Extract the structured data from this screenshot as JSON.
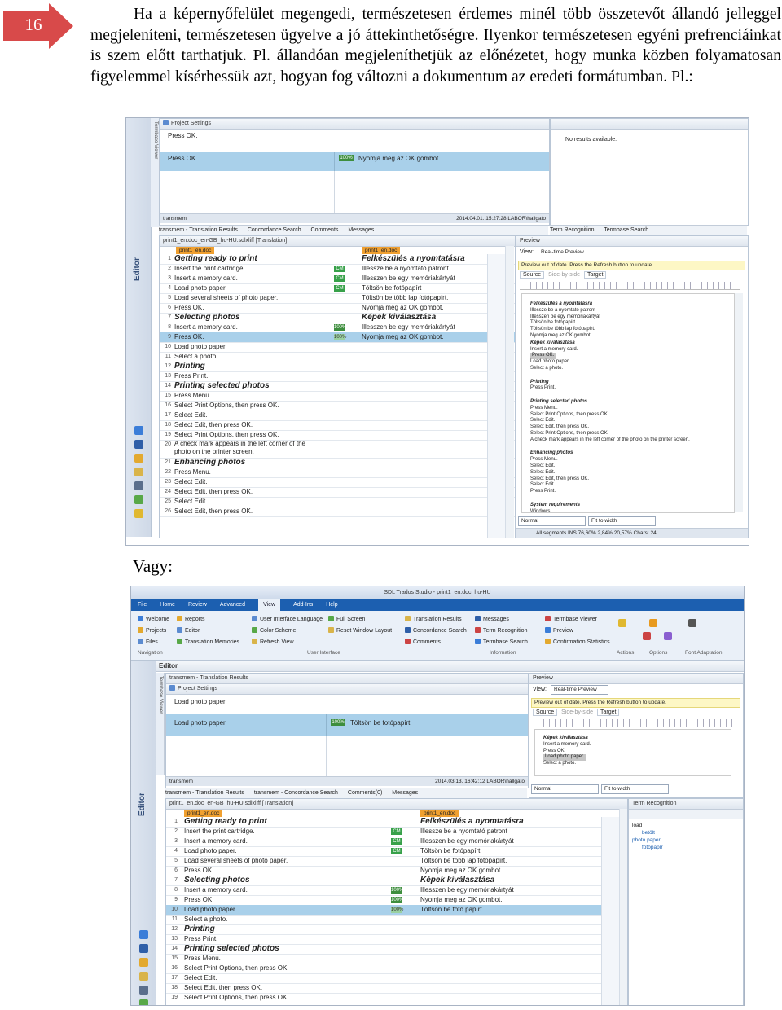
{
  "page_number": "16",
  "paragraph": "Ha a képernyőfelület megengedi, természetesen érdemes minél több összetevőt állandó jelleggel megjeleníteni, természetesen ügyelve a jó áttekinthetőségre. Ilyenkor természetesen egyéni prefrenciáinkat is szem előtt tarthatjuk. Pl. állandóan megjeleníthetjük az előnézetet, hogy munka közben folyamatosan figyelemmel kísérhessük azt, hogyan fog változni a dokumentum az eredeti formátumban. Pl.:",
  "vagy": "Vagy:",
  "colors": {
    "arrow": "#d84a4a",
    "selection": "#a9d0ea",
    "cm": "#38a14a",
    "menubar": "#1c5fb0"
  },
  "shot1": {
    "termbase_viewer": "Termbase Viewer",
    "project_settings": "Project Settings",
    "press_ok_label": "Press OK.",
    "press_ok_src": "Press OK.",
    "match_pct": "100%",
    "match_tgt": "Nyomja meg az OK gombot.",
    "no_results": "No results available.",
    "tm_status_left": "transmem",
    "tm_status_right": "2014.04.01. 15:27:28 LABOR\\hallgato",
    "tabs": [
      "transmem - Translation Results",
      "Concordance Search",
      "Comments",
      "Messages"
    ],
    "right_tabs": [
      "Term Recognition",
      "Termbase Search"
    ],
    "file_title": "print1_en.doc_en-GB_hu-HU.sdlxliff [Translation]",
    "editor_label": "Editor",
    "src_tag": "print1_en.doc",
    "tgt_tag": "print1_en.doc",
    "preview_title": "Preview",
    "view_label": "View:",
    "view_value": "Real-time Preview",
    "out_of_date": "Preview out of date. Press the Refresh button to update.",
    "preview_tabs": [
      "Source",
      "Side-by-side",
      "Target"
    ],
    "zoom_normal": "Normal",
    "zoom_fit": "Fit to width",
    "status_bar": "All segments  INS  76,60%  2,84%  20,57%  Chars: 24",
    "rows": [
      {
        "n": "1",
        "src": "Getting ready to print",
        "tgt": "Felkészülés a nyomtatásra",
        "st": "",
        "ty": "H",
        "hd": true
      },
      {
        "n": "2",
        "src": "Insert the print cartridge.",
        "tgt": "Illessze be a nyomtató patront",
        "st": "CM",
        "ty": "P"
      },
      {
        "n": "3",
        "src": "Insert a memory card.",
        "tgt": "Illesszen be egy memóriakártyát",
        "st": "CM",
        "ty": "P"
      },
      {
        "n": "4",
        "src": "Load photo paper.",
        "tgt": "Töltsön be  fotópapírt",
        "st": "CM",
        "ty": "P"
      },
      {
        "n": "5",
        "src": "Load several sheets of photo paper.",
        "tgt": "Töltsön be több lap fotópapírt.",
        "st": "",
        "ty": "P"
      },
      {
        "n": "6",
        "src": "Press OK.",
        "tgt": "Nyomja meg az OK gombot.",
        "st": "",
        "ty": "P"
      },
      {
        "n": "7",
        "src": "Selecting photos",
        "tgt": "Képek kiválasztása",
        "st": "",
        "ty": "H",
        "hd": true
      },
      {
        "n": "8",
        "src": "Insert a memory card.",
        "tgt": "Illesszen be egy memóriakártyát",
        "st": "100%",
        "ty": "P"
      },
      {
        "n": "9",
        "src": "Press OK.",
        "tgt": "Nyomja meg az OK gombot.",
        "st": "100%",
        "ty": "P",
        "sel": true
      },
      {
        "n": "10",
        "src": "Load photo paper.",
        "tgt": "",
        "st": "",
        "ty": "P"
      },
      {
        "n": "11",
        "src": "Select a photo.",
        "tgt": "",
        "st": "",
        "ty": "P"
      },
      {
        "n": "12",
        "src": "Printing",
        "tgt": "",
        "st": "",
        "ty": "H",
        "hd": true
      },
      {
        "n": "13",
        "src": "Press Print.",
        "tgt": "",
        "st": "",
        "ty": "P"
      },
      {
        "n": "14",
        "src": "Printing selected photos",
        "tgt": "",
        "st": "",
        "ty": "H",
        "hd": true
      },
      {
        "n": "15",
        "src": "Press Menu.",
        "tgt": "",
        "st": "",
        "ty": "P"
      },
      {
        "n": "16",
        "src": "Select Print Options, then press OK.",
        "tgt": "",
        "st": "",
        "ty": "P"
      },
      {
        "n": "17",
        "src": "Select Edit.",
        "tgt": "",
        "st": "",
        "ty": "P"
      },
      {
        "n": "18",
        "src": "Select Edit, then press OK.",
        "tgt": "",
        "st": "",
        "ty": "P"
      },
      {
        "n": "19",
        "src": "Select Print Options, then press OK.",
        "tgt": "",
        "st": "",
        "ty": "P"
      },
      {
        "n": "20",
        "src": "A check mark appears in the left corner of the photo on the printer screen.",
        "tgt": "",
        "st": "",
        "ty": "P",
        "tall": true
      },
      {
        "n": "21",
        "src": "Enhancing photos",
        "tgt": "",
        "st": "",
        "ty": "H",
        "hd": true
      },
      {
        "n": "22",
        "src": "Press Menu.",
        "tgt": "",
        "st": "",
        "ty": "P"
      },
      {
        "n": "23",
        "src": "Select Edit.",
        "tgt": "",
        "st": "",
        "ty": "P"
      },
      {
        "n": "24",
        "src": "Select Edit, then press OK.",
        "tgt": "",
        "st": "",
        "ty": "P"
      },
      {
        "n": "25",
        "src": "Select Edit.",
        "tgt": "",
        "st": "",
        "ty": "P"
      },
      {
        "n": "26",
        "src": "Select Edit, then press OK.",
        "tgt": "",
        "st": "",
        "ty": "P"
      }
    ],
    "preview_lines": [
      {
        "t": "Felkészülés a nyomtatásra",
        "b": true
      },
      {
        "t": "Illessze be a nyomtató patront"
      },
      {
        "t": "Illesszen be egy memóriakártyát"
      },
      {
        "t": "Töltsön be  fotópapírt"
      },
      {
        "t": "Töltsön be több lap fotópapírt."
      },
      {
        "t": "Nyomja meg az OK gombot."
      },
      {
        "t": "Képek kiválasztása",
        "b": true
      },
      {
        "t": "Insert a memory card."
      },
      {
        "t": "Press OK.",
        "hl": true
      },
      {
        "t": "Load photo paper."
      },
      {
        "t": "Select a photo."
      },
      {
        "t": ""
      },
      {
        "t": "Printing",
        "b": true
      },
      {
        "t": "Press Print."
      },
      {
        "t": ""
      },
      {
        "t": "Printing selected photos",
        "b": true
      },
      {
        "t": "Press Menu."
      },
      {
        "t": "Select Print Options, then press OK."
      },
      {
        "t": "Select Edit."
      },
      {
        "t": "Select Edit, then press OK."
      },
      {
        "t": "Select Print Options, then press OK."
      },
      {
        "t": "A check mark appears in the left corner of the photo on the printer screen."
      },
      {
        "t": ""
      },
      {
        "t": "Enhancing photos",
        "b": true
      },
      {
        "t": "Press Menu."
      },
      {
        "t": "Select Edit."
      },
      {
        "t": "Select Edit."
      },
      {
        "t": "Select Edit, then press OK."
      },
      {
        "t": "Select Edit."
      },
      {
        "t": "Press Print."
      },
      {
        "t": ""
      },
      {
        "t": "System requirements",
        "b": true
      },
      {
        "t": "Windows"
      }
    ]
  },
  "shot2": {
    "window_title": "SDL Trados Studio - print1_en.doc_hu-HU",
    "menu": [
      "File",
      "Home",
      "Review",
      "Advanced",
      "View",
      "Add-Ins",
      "Help"
    ],
    "menu_active": "View",
    "groups": [
      {
        "items": [
          "Welcome",
          "Projects",
          "Files"
        ],
        "cap": "Navigation"
      },
      {
        "items": [
          "Reports",
          "Editor",
          "Translation Memories"
        ],
        "cap": ""
      },
      {
        "items": [
          "User Interface Language",
          "Color Scheme",
          "Refresh View"
        ],
        "cap": "User Interface"
      },
      {
        "items": [
          "Full Screen",
          "Reset Window Layout"
        ],
        "cap": ""
      },
      {
        "items": [
          "Translation Results",
          "Concordance Search",
          "Comments"
        ],
        "cap": ""
      },
      {
        "items": [
          "Messages",
          "Term Recognition",
          "Termbase Search"
        ],
        "cap": "Information"
      },
      {
        "items": [
          "Termbase Viewer",
          "Preview",
          "Confirmation Statistics"
        ],
        "cap": ""
      }
    ],
    "right_caps": [
      "Actions",
      "Options",
      "Font Adaptation"
    ],
    "editor_label": "Editor",
    "tm_title": "transmem - Translation Results",
    "project_settings": "Project Settings",
    "load_label": "Load photo paper.",
    "load_src": "Load photo paper.",
    "match_pct": "100%",
    "match_tgt": "Töltsön be  fotópapírt",
    "tm_status_left": "transmem",
    "tm_status_right": "2014.03.13. 16:42:12 LABOR\\hallgato",
    "tabs": [
      "transmem - Translation Results",
      "transmem - Concordance Search",
      "Comments(0)",
      "Messages"
    ],
    "file_title": "print1_en.doc_en-GB_hu-HU.sdlxliff [Translation]",
    "termbase_viewer": "Termbase Viewer",
    "src_tag": "print1_en.doc",
    "tgt_tag": "print1_en.doc",
    "preview_title": "Preview",
    "view_label": "View:",
    "view_value": "Real-time Preview",
    "out_of_date": "Preview out of date. Press the Refresh button to update.",
    "preview_tabs": [
      "Source",
      "Side-by-side",
      "Target"
    ],
    "zoom_normal": "Normal",
    "zoom_fit": "Fit to width",
    "term_title": "Term Recognition",
    "terms": [
      {
        "t": "load",
        "c": "#222"
      },
      {
        "t": "betölt",
        "c": "#1c5fb0",
        "ind": true
      },
      {
        "t": "photo paper",
        "c": "#1c5fb0"
      },
      {
        "t": "fotópapír",
        "c": "#1c5fb0",
        "ind": true
      }
    ],
    "preview_lines": [
      {
        "t": "Képek kiválasztása",
        "b": true
      },
      {
        "t": "Insert a memory card."
      },
      {
        "t": "Press OK."
      },
      {
        "t": "Load photo paper.",
        "hl": true
      },
      {
        "t": "Select a photo."
      }
    ],
    "rows": [
      {
        "n": "1",
        "src": "Getting ready to print",
        "tgt": "Felkészülés a nyomtatásra",
        "st": "",
        "ty": "H",
        "hd": true
      },
      {
        "n": "2",
        "src": "Insert the print cartridge.",
        "tgt": "Illessze be a nyomtató patront",
        "st": "CM",
        "ty": "P"
      },
      {
        "n": "3",
        "src": "Insert a memory card.",
        "tgt": "Illesszen be egy memóriakártyát",
        "st": "CM",
        "ty": "P"
      },
      {
        "n": "4",
        "src": "Load photo paper.",
        "tgt": "Töltsön be  fotópapírt",
        "st": "CM",
        "ty": "P"
      },
      {
        "n": "5",
        "src": "Load several sheets of photo paper.",
        "tgt": "Töltsön be több lap fotópapírt.",
        "st": "",
        "ty": "P"
      },
      {
        "n": "6",
        "src": "Press OK.",
        "tgt": "Nyomja meg az OK gombot.",
        "st": "",
        "ty": "P"
      },
      {
        "n": "7",
        "src": "Selecting photos",
        "tgt": "Képek kiválasztása",
        "st": "",
        "ty": "H",
        "hd": true
      },
      {
        "n": "8",
        "src": "Insert a memory card.",
        "tgt": "Illesszen be egy memóriakártyát",
        "st": "100%",
        "ty": "P"
      },
      {
        "n": "9",
        "src": "Press OK.",
        "tgt": "Nyomja meg az OK gombot.",
        "st": "100%",
        "ty": "P"
      },
      {
        "n": "10",
        "src": "Load photo paper.",
        "tgt": "Töltsön be  fotó papírt",
        "st": "100%",
        "ty": "P",
        "sel": true
      },
      {
        "n": "11",
        "src": "Select a photo.",
        "tgt": "",
        "st": "",
        "ty": "P"
      },
      {
        "n": "12",
        "src": "Printing",
        "tgt": "",
        "st": "",
        "ty": "H",
        "hd": true
      },
      {
        "n": "13",
        "src": "Press Print.",
        "tgt": "",
        "st": "",
        "ty": "P"
      },
      {
        "n": "14",
        "src": "Printing selected photos",
        "tgt": "",
        "st": "",
        "ty": "H",
        "hd": true
      },
      {
        "n": "15",
        "src": "Press Menu.",
        "tgt": "",
        "st": "",
        "ty": "P"
      },
      {
        "n": "16",
        "src": "Select Print Options, then press OK.",
        "tgt": "",
        "st": "",
        "ty": "P"
      },
      {
        "n": "17",
        "src": "Select Edit.",
        "tgt": "",
        "st": "",
        "ty": "P"
      },
      {
        "n": "18",
        "src": "Select Edit, then press OK.",
        "tgt": "",
        "st": "",
        "ty": "P"
      },
      {
        "n": "19",
        "src": "Select Print Options, then press OK.",
        "tgt": "",
        "st": "",
        "ty": "P"
      }
    ]
  }
}
